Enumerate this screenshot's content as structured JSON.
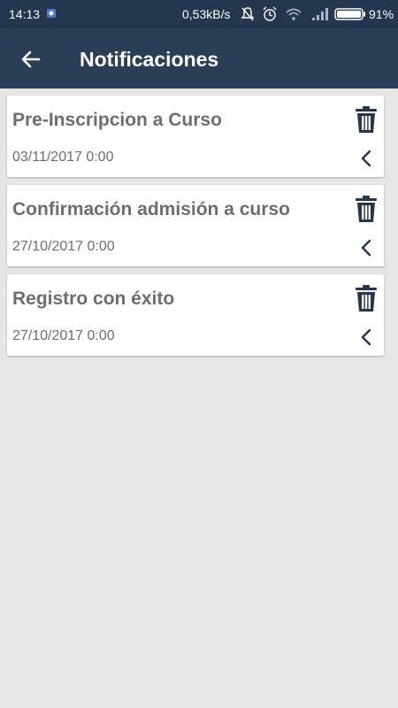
{
  "status_bar": {
    "time": "14:13",
    "network_speed": "0,53kB/s",
    "battery": "91%",
    "icons": [
      "app-notification-icon",
      "mute-bell-icon",
      "alarm-icon",
      "wifi-icon",
      "signal-icon",
      "battery-icon"
    ]
  },
  "app_bar": {
    "title": "Notificaciones",
    "back_icon": "arrow-left-icon",
    "color": "#2a3e55"
  },
  "notifications": [
    {
      "title": "Pre-Inscripcion a Curso",
      "date": "03/11/2017 0:00"
    },
    {
      "title": "Confirmación admisión a curso",
      "date": "27/10/2017 0:00"
    },
    {
      "title": "Registro con éxito",
      "date": "27/10/2017 0:00"
    }
  ],
  "item_icons": {
    "delete": "trash-icon",
    "expand": "chevron-left-icon",
    "color": "#24374e"
  },
  "colors": {
    "background": "#e6e6e6",
    "card": "#ffffff",
    "text": "#6e6e6e"
  }
}
